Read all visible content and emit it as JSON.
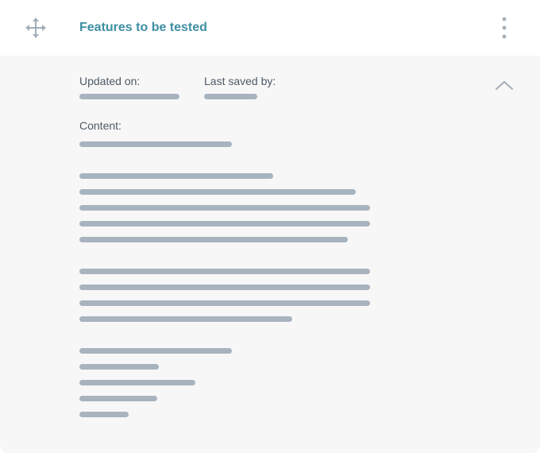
{
  "header": {
    "title": "Features to be tested",
    "move_icon": "move-arrows-icon",
    "more_icon": "vertical-ellipsis-icon"
  },
  "meta": {
    "updated_label": "Updated on:",
    "saved_by_label": "Last saved by:"
  },
  "content": {
    "label": "Content:"
  },
  "collapse_icon": "chevron-up-icon",
  "colors": {
    "title": "#3e8ea3",
    "placeholder_bar": "#a8b3bf",
    "body_bg": "#f7f7f7",
    "header_bg": "#ffffff",
    "icon": "#a3aeb8"
  }
}
